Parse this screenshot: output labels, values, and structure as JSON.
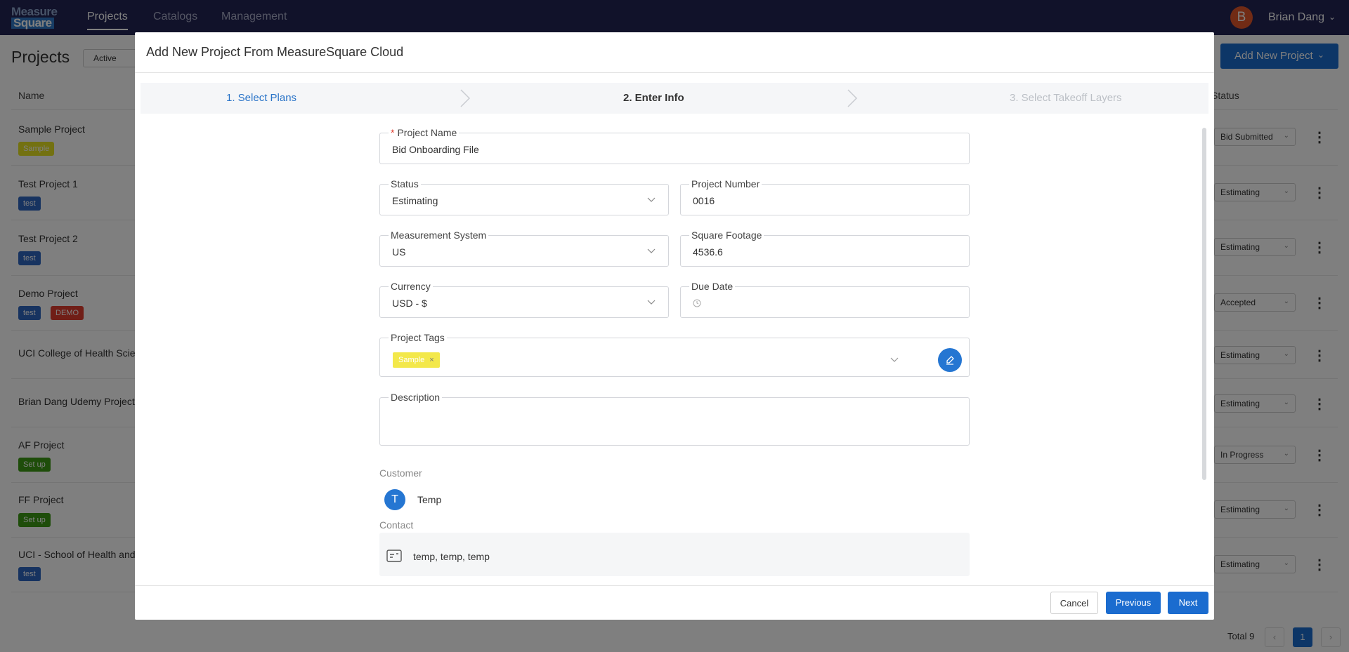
{
  "nav": {
    "logo_line1": "Measure",
    "logo_line2": "Square",
    "links": [
      "Projects",
      "Catalogs",
      "Management"
    ],
    "user_initial": "B",
    "user_name": "Brian Dang"
  },
  "page": {
    "title": "Projects",
    "filter_value": "Active",
    "add_button_label": "Add New Project",
    "col_name": "Name",
    "col_status": "Status",
    "rows": [
      {
        "name": "Sample Project",
        "tags": [
          "Sample"
        ],
        "status": "Bid Submitted"
      },
      {
        "name": "Test Project 1",
        "tags": [
          "test"
        ],
        "status": "Estimating"
      },
      {
        "name": "Test Project 2",
        "tags": [
          "test"
        ],
        "status": "Estimating"
      },
      {
        "name": "Demo Project",
        "tags": [
          "test",
          "DEMO"
        ],
        "status": "Accepted"
      },
      {
        "name": "UCI College of Health Scier",
        "tags": [],
        "status": "Estimating"
      },
      {
        "name": "Brian Dang Udemy Project",
        "tags": [],
        "status": "Estimating"
      },
      {
        "name": "AF Project",
        "tags": [
          "Set up"
        ],
        "status": "In Progress"
      },
      {
        "name": "FF Project",
        "tags": [
          "Set up"
        ],
        "status": "Estimating"
      },
      {
        "name": "UCI - School of Health and I",
        "tags": [
          "test"
        ],
        "status": "Estimating"
      }
    ],
    "total_label": "Total 9",
    "current_page": "1"
  },
  "modal": {
    "title": "Add New Project From MeasureSquare Cloud",
    "steps": [
      "1. Select Plans",
      "2. Enter Info",
      "3. Select Takeoff Layers"
    ],
    "fields": {
      "project_name": {
        "label": "Project Name",
        "value": "Bid Onboarding File"
      },
      "status": {
        "label": "Status",
        "value": "Estimating"
      },
      "project_number": {
        "label": "Project Number",
        "value": "0016"
      },
      "measurement_system": {
        "label": "Measurement System",
        "value": "US"
      },
      "square_footage": {
        "label": "Square Footage",
        "value": "4536.6"
      },
      "currency": {
        "label": "Currency",
        "value": "USD - $"
      },
      "due_date": {
        "label": "Due Date",
        "value": ""
      },
      "project_tags": {
        "label": "Project Tags",
        "tags": [
          "Sample"
        ]
      },
      "description": {
        "label": "Description",
        "value": ""
      }
    },
    "customer_label": "Customer",
    "customer_initial": "T",
    "customer_name": "Temp",
    "contact_label": "Contact",
    "contact_value": "temp, temp, temp",
    "buttons": {
      "cancel": "Cancel",
      "previous": "Previous",
      "next": "Next"
    }
  },
  "colors": {
    "nav_bg": "#232454",
    "primary": "#1b6ccf",
    "tag_yellow": "#e7e322",
    "tag_blue": "#2f66c0",
    "tag_red": "#e03c2e",
    "tag_green": "#3c9a14"
  }
}
